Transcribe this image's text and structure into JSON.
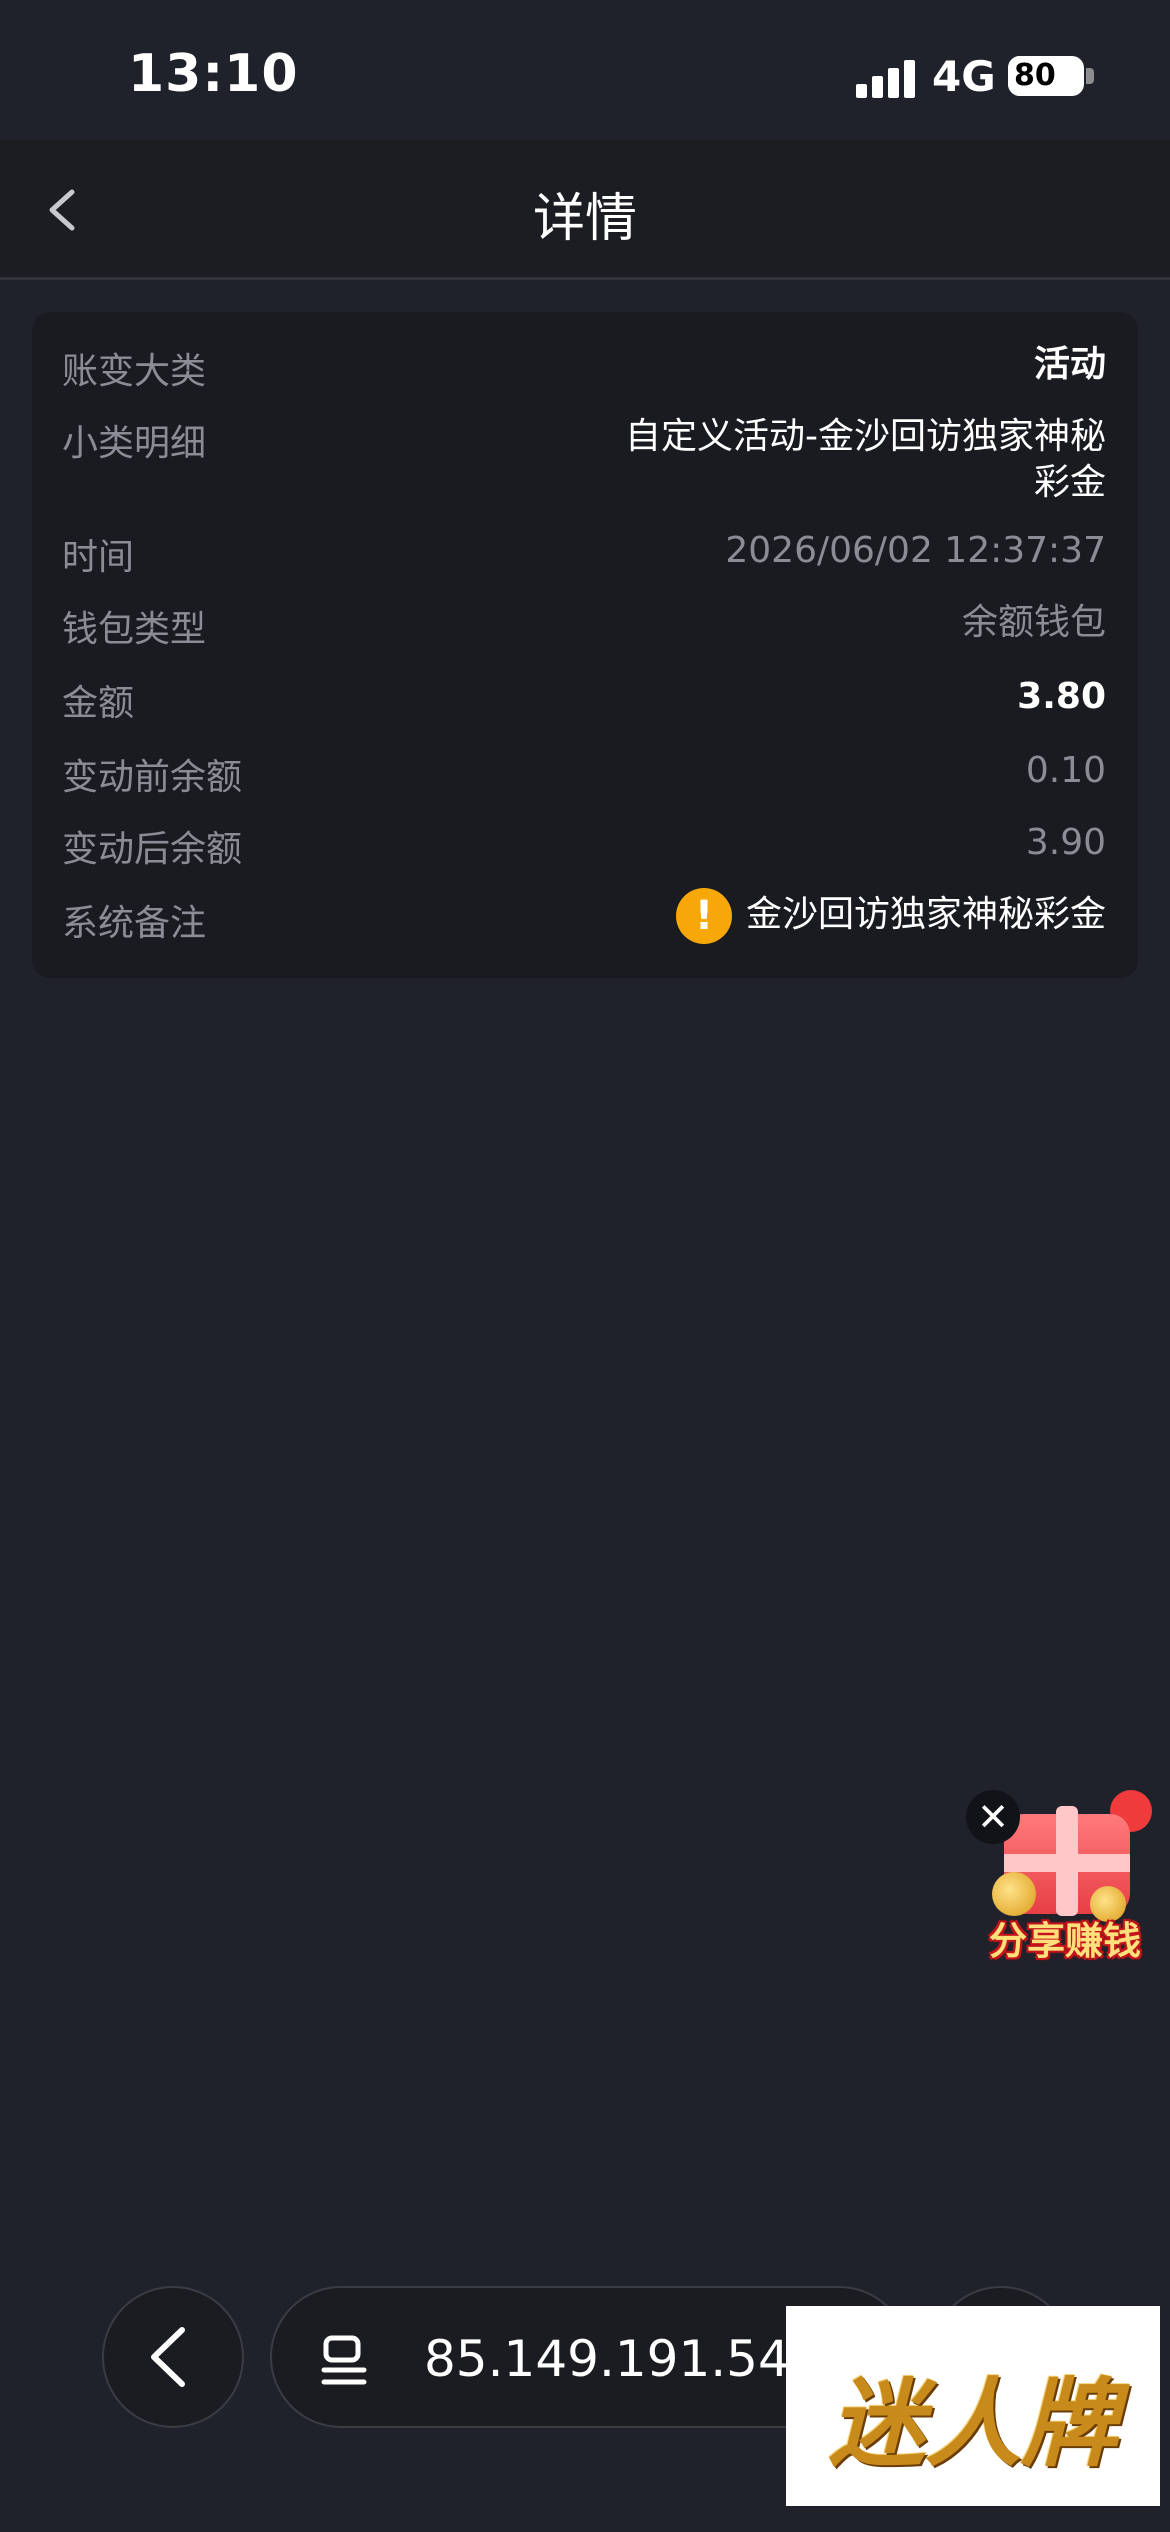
{
  "status_bar": {
    "time": "13:10",
    "network": "4G",
    "battery": "80",
    "battery_level_percent": 80
  },
  "nav": {
    "title": "详情",
    "back_icon": "chevron-left-icon"
  },
  "details": [
    {
      "label": "账变大类",
      "value": "活动",
      "style": "strong"
    },
    {
      "label": "小类明细",
      "value_lines": [
        "自定义活动-金沙回访独家神秘",
        "彩金"
      ],
      "style": "white"
    },
    {
      "label": "时间",
      "value": "2026/06/02 12:37:37",
      "style": "dim"
    },
    {
      "label": "钱包类型",
      "value": "余额钱包",
      "style": "dim"
    },
    {
      "label": "金额",
      "value": "3.80",
      "style": "strong"
    },
    {
      "label": "变动前余额",
      "value": "0.10",
      "style": "dim"
    },
    {
      "label": "变动后余额",
      "value": "3.90",
      "style": "dim"
    },
    {
      "label": "系统备注",
      "value": "金沙回访独家神秘彩金",
      "icon": "warning-icon",
      "icon_text": "!",
      "style": "white"
    }
  ],
  "floating_promo": {
    "label": "分享赚钱",
    "close": "✕"
  },
  "browser_bar": {
    "url": "85.149.191.54"
  },
  "watermark": {
    "text": "迷人牌"
  },
  "colors": {
    "background": "#20222b",
    "card": "#1a1b21",
    "label": "#8b8d96",
    "warning": "#f7a707"
  }
}
